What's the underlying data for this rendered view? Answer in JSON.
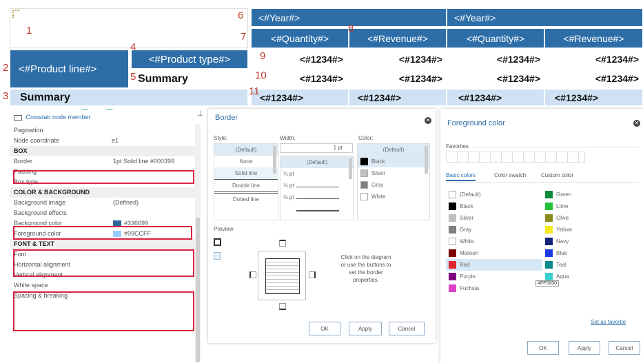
{
  "crosstab": {
    "year_1": "<#Year#>",
    "year_2": "<#Year#>",
    "quantity_1": "<#Quantity#>",
    "revenue_1": "<#Revenue#>",
    "quantity_2": "<#Quantity#>",
    "revenue_2": "<#Revenue#>",
    "product_line": "<#Product line#>",
    "product_type": "<#Product type#>",
    "summary_inner": "Summary",
    "summary_outer": "Summary",
    "row9": [
      "<#1234#>",
      "<#1234#>",
      "<#1234#>",
      "<#1234#>"
    ],
    "row10": [
      "<#1234#>",
      "<#1234#>",
      "<#1234#>",
      "<#1234#>"
    ],
    "row11": [
      "<#1234#>",
      "<#1234#>",
      "<#1234#>",
      "<#1234#>"
    ],
    "markers": [
      "1",
      "2",
      "3",
      "4",
      "5",
      "6",
      "7",
      "8",
      "9",
      "10",
      "11"
    ]
  },
  "properties": {
    "header": "Crosstab node member",
    "rows": {
      "pagination": "Pagination",
      "node_coordinate": "Node coordinate",
      "node_coordinate_value": "e1",
      "box": "BOX",
      "border": "Border",
      "border_value": "1pt  Solid line  #000399",
      "padding": "Padding",
      "box_type": "Box type",
      "color_bg": "COLOR & BACKGROUND",
      "background_image": "Background image",
      "background_image_value": "(Defined)",
      "background_effects": "Background effects",
      "background_color": "Background color",
      "background_color_value": "#336699",
      "foreground_color": "Foreground color",
      "foreground_color_value": "#99CCFF",
      "font_text": "FONT & TEXT",
      "font": "Font",
      "horizontal_alignment": "Horizontal alignment",
      "vertical_alignment": "Vertical alignment",
      "white_space": "White space",
      "spacing_breaking": "Spacing & breaking"
    },
    "colors": {
      "background": "#336699",
      "foreground": "#99CCFF"
    }
  },
  "border_dialog": {
    "title": "Border",
    "style_label": "Style:",
    "width_label": "Width:",
    "color_label": "Color:",
    "width_input": "1 pt",
    "styles": [
      "(Default)",
      "None",
      "Solid line",
      "Double line",
      "Dotted line"
    ],
    "widths": [
      "(Default)",
      "¼ pt",
      "½ pt",
      "¾ pt"
    ],
    "colors": [
      "(Default)",
      "Black",
      "Silver",
      "Gray",
      "White"
    ],
    "preview_label": "Preview",
    "instructions": "Click on the diagram or use the buttons to set the border properties.",
    "ok": "OK",
    "apply": "Apply",
    "cancel": "Cancel"
  },
  "fg_dialog": {
    "title": "Foreground color",
    "favorites": "Favorites",
    "tabs": [
      "Basic colors",
      "Color swatch",
      "Custom color"
    ],
    "left_colors": [
      {
        "name": "(Default)",
        "hex": "#ffffff"
      },
      {
        "name": "Black",
        "hex": "#000000"
      },
      {
        "name": "Silver",
        "hex": "#C0C0C0"
      },
      {
        "name": "Gray",
        "hex": "#808080"
      },
      {
        "name": "White",
        "hex": "#ffffff"
      },
      {
        "name": "Maroon",
        "hex": "#800000"
      },
      {
        "name": "Red",
        "hex": "#E0252F"
      },
      {
        "name": "Purple",
        "hex": "#800080"
      },
      {
        "name": "Fuchsia",
        "hex": "#E040C8"
      }
    ],
    "right_colors": [
      {
        "name": "Green",
        "hex": "#0A8A3A"
      },
      {
        "name": "Lime",
        "hex": "#22C03A"
      },
      {
        "name": "Olive",
        "hex": "#8A8A1A"
      },
      {
        "name": "Yellow",
        "hex": "#F4E81A"
      },
      {
        "name": "Navy",
        "hex": "#12247A"
      },
      {
        "name": "Blue",
        "hex": "#1A3AE0"
      },
      {
        "name": "Teal",
        "hex": "#0A8A8A"
      },
      {
        "name": "Aqua",
        "hex": "#3AD0D0"
      }
    ],
    "tooltip": "#FF0000",
    "set_as_favorite": "Set as favorite",
    "ok": "OK",
    "apply": "Apply",
    "cancel": "Cancel"
  }
}
